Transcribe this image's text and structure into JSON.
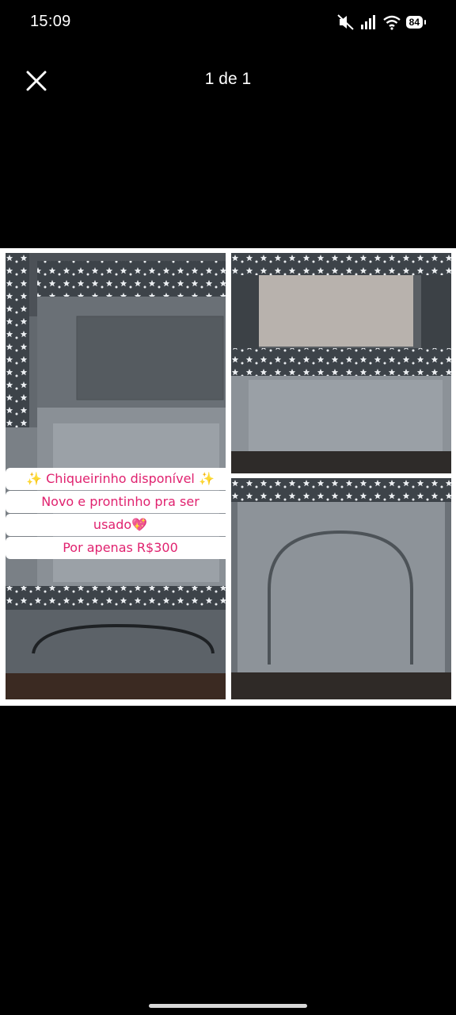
{
  "status_bar": {
    "time": "15:09",
    "battery_level": "84",
    "icons": [
      "mute-icon",
      "signal-icon",
      "wifi-icon",
      "battery-icon"
    ]
  },
  "viewer": {
    "page_counter": "1 de 1",
    "close_icon": "close-icon"
  },
  "photo": {
    "caption_line1": "Chiqueirinho disponível",
    "caption_line2": "Novo e prontinho pra ser",
    "caption_line3": "usado",
    "caption_line4": "Por apenas R$300",
    "sparkle_emoji": "✨",
    "heart_emoji": "💖",
    "caption_color": "#e0226f"
  }
}
